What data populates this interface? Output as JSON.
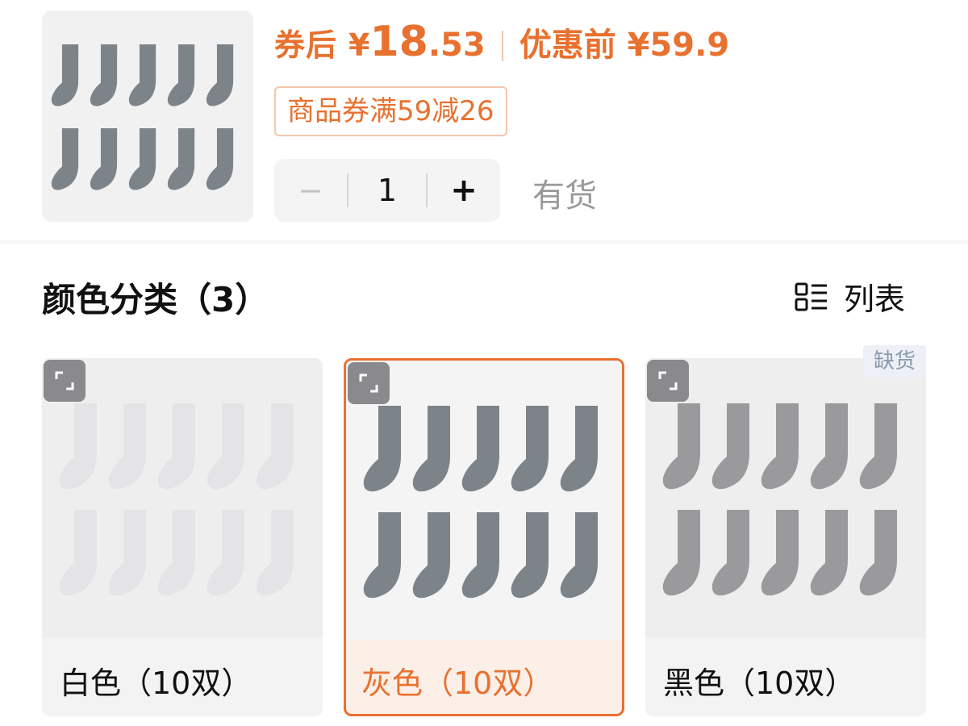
{
  "product": {
    "price_label": "券后",
    "currency": "¥",
    "price_int": "18",
    "price_dec": ".53",
    "original_label": "优惠前 ¥59.9",
    "coupon": "商品券满59减26",
    "quantity": "1",
    "minus": "−",
    "plus": "+",
    "stock": "有货",
    "accent_color": "#e8712f"
  },
  "section": {
    "title": "颜色分类（3）",
    "list_toggle_label": "列表",
    "list_toggle_icon": "list-view-icon"
  },
  "variants": [
    {
      "name": "白色（10双）",
      "color": "#e4e4e6",
      "selected": false,
      "out_of_stock": false
    },
    {
      "name": "灰色（10双）",
      "color": "#7c8389",
      "selected": true,
      "out_of_stock": false
    },
    {
      "name": "黑色（10双）",
      "color": "#9a9a9c",
      "selected": false,
      "out_of_stock": true,
      "badge": "缺货"
    }
  ]
}
